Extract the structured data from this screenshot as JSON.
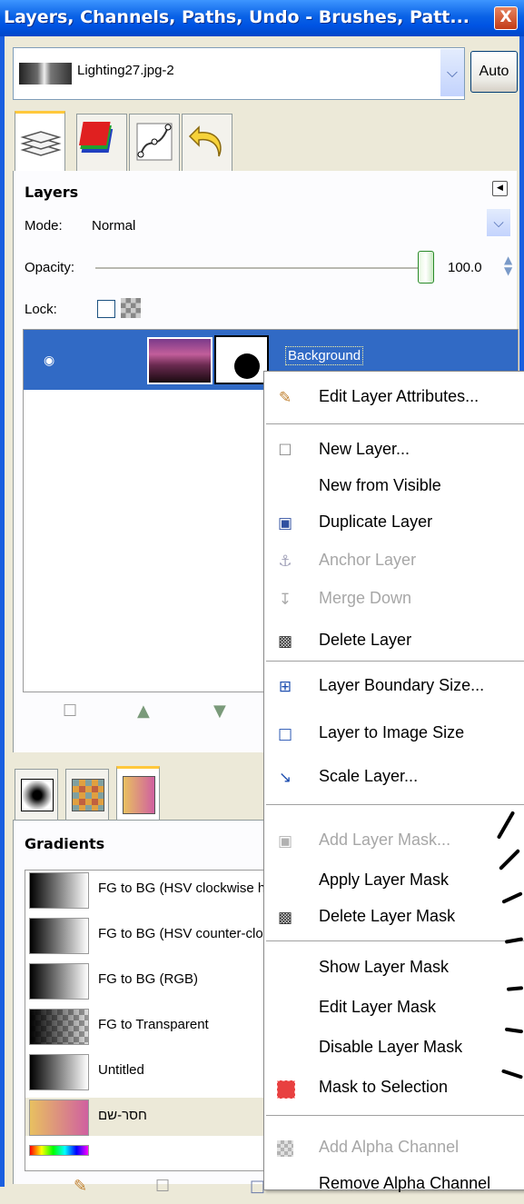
{
  "window": {
    "title": "Layers, Channels, Paths, Undo - Brushes, Patt...",
    "close_glyph": "X"
  },
  "image_selector": {
    "value": "Lighting27.jpg-2",
    "auto_label": "Auto"
  },
  "dock_tabs": [
    {
      "icon": "layers-icon"
    },
    {
      "icon": "channels-icon"
    },
    {
      "icon": "paths-icon"
    },
    {
      "icon": "undo-icon"
    }
  ],
  "layers_panel": {
    "title": "Layers",
    "mode_label": "Mode:",
    "mode_value": "Normal",
    "opacity_label": "Opacity:",
    "opacity_value": "100.0",
    "lock_label": "Lock:",
    "layers": [
      {
        "name": "Background",
        "visible": true,
        "selected": true
      }
    ]
  },
  "context_menu": {
    "items": [
      {
        "label": "Edit Layer Attributes...",
        "icon": "edit-icon",
        "disabled": false
      },
      {
        "separator": true
      },
      {
        "label": "New Layer...",
        "icon": "new-page-icon",
        "disabled": false
      },
      {
        "label": "New from Visible",
        "icon": "",
        "disabled": false
      },
      {
        "label": "Duplicate Layer",
        "icon": "duplicate-icon",
        "disabled": false
      },
      {
        "label": "Anchor Layer",
        "icon": "anchor-icon",
        "disabled": true
      },
      {
        "label": "Merge Down",
        "icon": "merge-icon",
        "disabled": true
      },
      {
        "label": "Delete Layer",
        "icon": "trash-icon",
        "disabled": false
      },
      {
        "separator": true
      },
      {
        "label": "Layer Boundary Size...",
        "icon": "boundary-icon",
        "disabled": false
      },
      {
        "label": "Layer to Image Size",
        "icon": "fit-image-icon",
        "disabled": false
      },
      {
        "label": "Scale Layer...",
        "icon": "scale-icon",
        "disabled": false
      },
      {
        "separator": true
      },
      {
        "label": "Add Layer Mask...",
        "icon": "add-mask-icon",
        "disabled": true
      },
      {
        "label": "Apply Layer Mask",
        "icon": "",
        "disabled": false
      },
      {
        "label": "Delete Layer Mask",
        "icon": "trash-icon",
        "disabled": false
      },
      {
        "separator": true
      },
      {
        "label": "Show Layer Mask",
        "icon": "",
        "disabled": false
      },
      {
        "label": "Edit Layer Mask",
        "icon": "",
        "disabled": false
      },
      {
        "label": "Disable Layer Mask",
        "icon": "",
        "disabled": false
      },
      {
        "label": "Mask to Selection",
        "icon": "selection-icon",
        "disabled": false
      },
      {
        "separator": true
      },
      {
        "label": "Add Alpha Channel",
        "icon": "alpha-icon",
        "disabled": true
      },
      {
        "label": "Remove Alpha Channel",
        "icon": "",
        "disabled": false
      }
    ]
  },
  "gradients_panel": {
    "title": "Gradients",
    "items": [
      {
        "name": "FG to BG (HSV clockwise hue)"
      },
      {
        "name": "FG to BG (HSV counter-clockwise)"
      },
      {
        "name": "FG to BG (RGB)"
      },
      {
        "name": "FG to Transparent"
      },
      {
        "name": "Untitled"
      },
      {
        "name": "חסר-שם"
      }
    ]
  },
  "colors": {
    "titlebar": "#0054E3",
    "selection": "#316AC5",
    "tab_accent": "#FFC83C",
    "mask_to_selection_icon": "#E84040"
  }
}
